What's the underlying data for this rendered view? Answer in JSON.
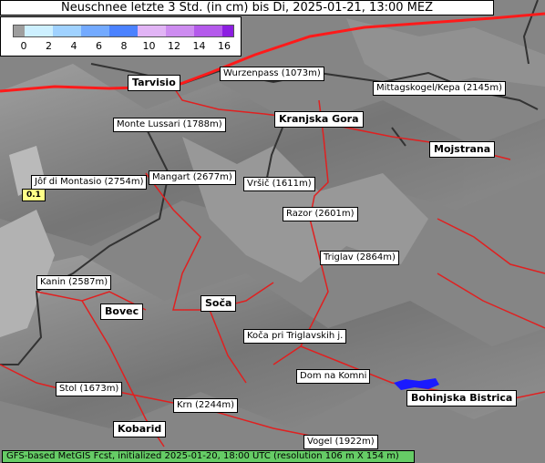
{
  "title": "Neuschnee letzte 3 Std. (in cm) bis Di, 2025-01-21, 13:00 MEZ",
  "legend": {
    "colors": [
      "#9e9e9e",
      "#cdf0ff",
      "#a0d2ff",
      "#73aaff",
      "#4b82ff",
      "#e1b4f5",
      "#cd8cf0",
      "#b45aeb",
      "#8c1ee1"
    ],
    "ticks": [
      "0",
      "2",
      "4",
      "6",
      "8",
      "10",
      "12",
      "14",
      "16"
    ]
  },
  "places": {
    "tarvisio": "Tarvisio",
    "wurzenpass": "Wurzenpass (1073m)",
    "mittagskogel": "Mittagskogel/Kepa (2145m)",
    "monte_lussari": "Monte Lussari (1788m)",
    "kranjska_gora": "Kranjska Gora",
    "mojstrana": "Mojstrana",
    "jof_di_montasio": "Jôf di Montasio (2754m)",
    "mangart": "Mangart (2677m)",
    "vrsic": "Vršič (1611m)",
    "razor": "Razor (2601m)",
    "triglav": "Triglav (2864m)",
    "kanin": "Kanin (2587m)",
    "bovec": "Bovec",
    "soca": "Soča",
    "koca_triglav": "Koča pri Triglavskih j.",
    "dom_na_komni": "Dom na Komni",
    "stol": "Stol (1673m)",
    "krn": "Krn (2244m)",
    "bohinjska_bistrica": "Bohinjska Bistrica",
    "kobarid": "Kobarid",
    "vogel": "Vogel (1922m)"
  },
  "value_marker": "0.1",
  "footer": "GFS-based MetGIS Fcst, initialized 2025-01-20, 18:00 UTC  (resolution 106 m X 154 m)"
}
